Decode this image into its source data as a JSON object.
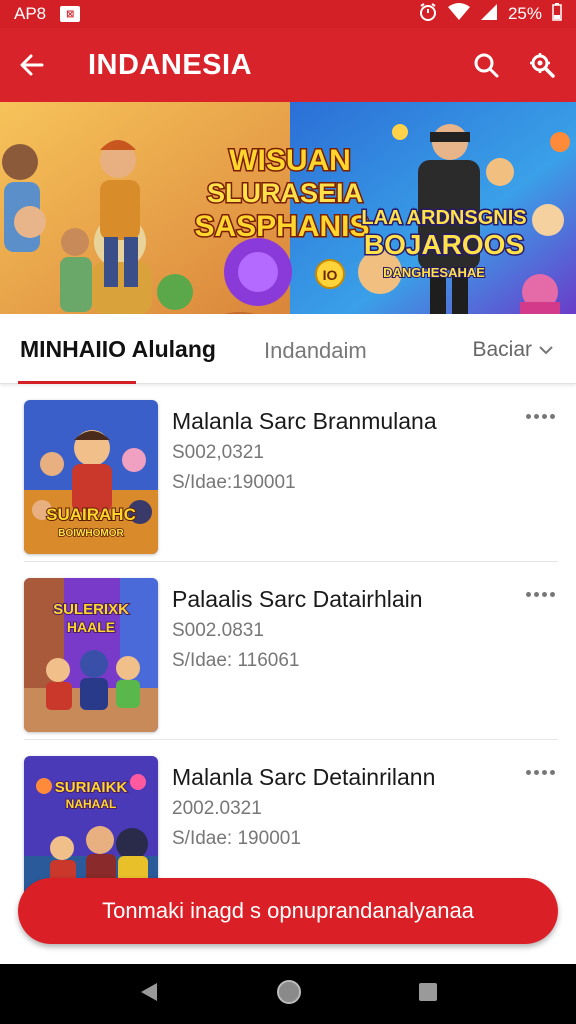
{
  "status_bar": {
    "left_text": "AP8",
    "battery": "25%",
    "icons": [
      "notification-badge-icon",
      "alarm-icon",
      "wifi-icon",
      "signal-icon",
      "battery-icon"
    ]
  },
  "app_bar": {
    "title": "INDANESIA",
    "icons": [
      "back-arrow-icon",
      "search-icon",
      "settings-icon"
    ]
  },
  "banner": {
    "headline_left": [
      "WISUAN",
      "SLURASEIA",
      "SASPHANIS"
    ],
    "headline_right": [
      "LAA ARDNSGNIS",
      "BOJAROOS",
      "DANGHESAHAE"
    ],
    "badge": "IO"
  },
  "tabs": {
    "active": "MINHAIIO Alulang",
    "second": "Indandaim",
    "filter": "Baciar"
  },
  "items": [
    {
      "title": "Malanla Sarc Branmulana",
      "price": "S002,0321",
      "meta": "S/Idae:190001",
      "thumb_caption": [
        "SUAIRAHC",
        "BOIWHOMOR"
      ]
    },
    {
      "title": "Palaalis Sarc Datairhlain",
      "price": "S002.0831",
      "meta": "S/Idae: 116061",
      "thumb_caption": [
        "SULERIXK",
        "HAALE"
      ]
    },
    {
      "title": "Malanla Sarc Detainrilann",
      "price": "2002.0321",
      "meta": "S/Idae: 190001",
      "thumb_caption": [
        "SURIAIKK",
        "NAHAAL"
      ]
    }
  ],
  "cta": {
    "label": "Tonmaki inagd s opnuprandanalyanaa"
  },
  "colors": {
    "primary_red": "#d8232a",
    "cta_red": "#db1f26"
  }
}
